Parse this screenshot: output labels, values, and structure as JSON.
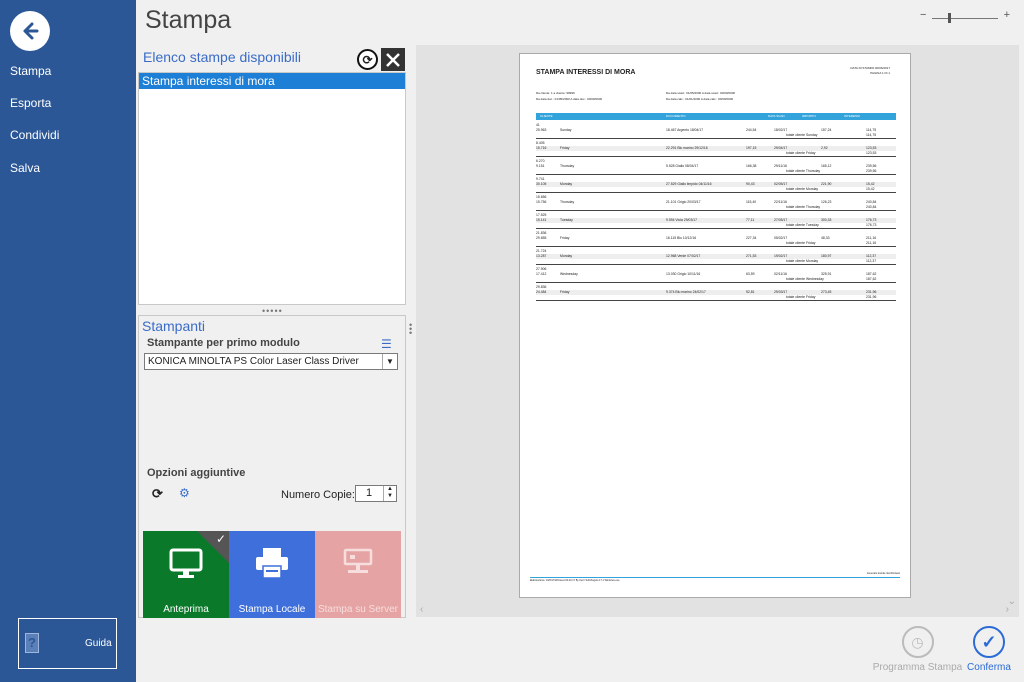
{
  "nav": {
    "items": [
      "Stampa",
      "Esporta",
      "Condividi",
      "Salva"
    ],
    "guida_label": "Guida"
  },
  "header": {
    "title": "Stampa"
  },
  "elenco": {
    "title": "Elenco stampe disponibili",
    "items": [
      "Stampa interessi di mora"
    ]
  },
  "printers": {
    "title": "Stampanti",
    "sub_label": "Stampante per primo modulo",
    "selected": "KONICA MINOLTA PS Color Laser Class Driver",
    "options_label": "Opzioni aggiuntive",
    "copies_label": "Numero Copie:",
    "copies_value": "1"
  },
  "tiles": {
    "preview": "Anteprima",
    "locale": "Stampa Locale",
    "server": "Stampa su Server"
  },
  "actions": {
    "programma": "Programma Stampa",
    "conferma": "Conferma"
  },
  "report": {
    "title": "STAMPA INTERESSI DI MORA",
    "date_line1": "DATA DI STAMPA 00/06/2017",
    "date_line2": "PAGINA 1 DI 1",
    "filters": [
      [
        "Da cliente: 1 a cliente: 99999",
        "Da data scad.: 01/05/2000  A data scad.: 00/00/0000",
        ""
      ],
      [
        "Da data doc.: 01/05/2000  A data doc.: 00/00/0000",
        "Da data calc.: 01/01/2000  A data calc.: 00/00/0000",
        ""
      ]
    ],
    "columns": [
      "CLIENTE",
      "DOCUMENTO",
      "DATA SCAD.",
      "IMPORTO",
      "INTERESSI"
    ],
    "rows": [
      {
        "code": "41",
        "id": "25.963",
        "name": "Sunday",
        "doc": "18.467 Argento 18/04/17",
        "amt": "244,54",
        "date": "18/02/17",
        "imp": "157,24",
        "int": "114,75",
        "total_label": "totale cliente Sunday",
        "total": "114,75"
      },
      {
        "code": "8.405",
        "id": "15.716",
        "name": "Friday",
        "doc": "22.291 Blu marino 29/12/16",
        "amt": "197,15",
        "date": "29/04/17",
        "imp": "2,92",
        "int": "123,53",
        "total_label": "totale cliente Friday",
        "total": "123,53"
      },
      {
        "code": "6.270",
        "id": "9.151",
        "name": "Thursday",
        "doc": "5.528 Giallo 08/04/17",
        "amt": "166,38",
        "date": "29/11/16",
        "imp": "165,12",
        "int": "239,56",
        "total_label": "totale cliente Thursday",
        "total": "239,56"
      },
      {
        "code": "9.741",
        "id": "30.105",
        "name": "Monday",
        "doc": "27.529 Giallo limpido 04/11/16",
        "amt": "90,43",
        "date": "02/05/17",
        "imp": "221,90",
        "int": "15,42",
        "total_label": "totale cliente Monday",
        "total": "15,42"
      },
      {
        "code": "15.656",
        "id": "15.756",
        "name": "Thursday",
        "doc": "21.101 Grigio 20/03/17",
        "amt": "115,40",
        "date": "22/11/16",
        "imp": "126,23",
        "int": "240,84",
        "total_label": "totale cliente Thursday",
        "total": "240,84"
      },
      {
        "code": "17.525",
        "id": "15.141",
        "name": "Tuesday",
        "doc": "9.594 Viola 29/03/17",
        "amt": "77,11",
        "date": "27/05/17",
        "imp": "300,33",
        "int": "176,73",
        "total_label": "totale cliente Tuesday",
        "total": "176,73"
      },
      {
        "code": "21.836",
        "id": "29.655",
        "name": "Friday",
        "doc": "16.115 Blu 10/12/16",
        "amt": "227,34",
        "date": "05/02/17",
        "imp": "48,33",
        "int": "211,16",
        "total_label": "totale cliente Friday",
        "total": "211,16"
      },
      {
        "code": "21.724",
        "id": "13.287",
        "name": "Monday",
        "doc": "12.968 Verde 07/02/17",
        "amt": "271,53",
        "date": "19/02/17",
        "imp": "180,97",
        "int": "112,37",
        "total_label": "totale cliente Monday",
        "total": "112,37"
      },
      {
        "code": "27.906",
        "id": "17.412",
        "name": "Wednesday",
        "doc": "13.030 Grigio 10/11/16",
        "amt": "63,59",
        "date": "02/11/16",
        "imp": "325,91",
        "int": "187,62",
        "total_label": "totale cliente Wednesday",
        "total": "187,62"
      },
      {
        "code": "29.836",
        "id": "24.484",
        "name": "Friday",
        "doc": "9.374 Blu marino 24/02/17",
        "amt": "52,81",
        "date": "29/03/17",
        "imp": "273,45",
        "int": "231,96",
        "total_label": "totale cliente Friday",
        "total": "231,96"
      }
    ],
    "footer_left": "Elaborazione: 44/6/17/WinGest 00.00.17 By Kerr/ Soft/Angolo 17.1 Windows.exe",
    "footer_right": "Generato tramite /da WinGest"
  }
}
